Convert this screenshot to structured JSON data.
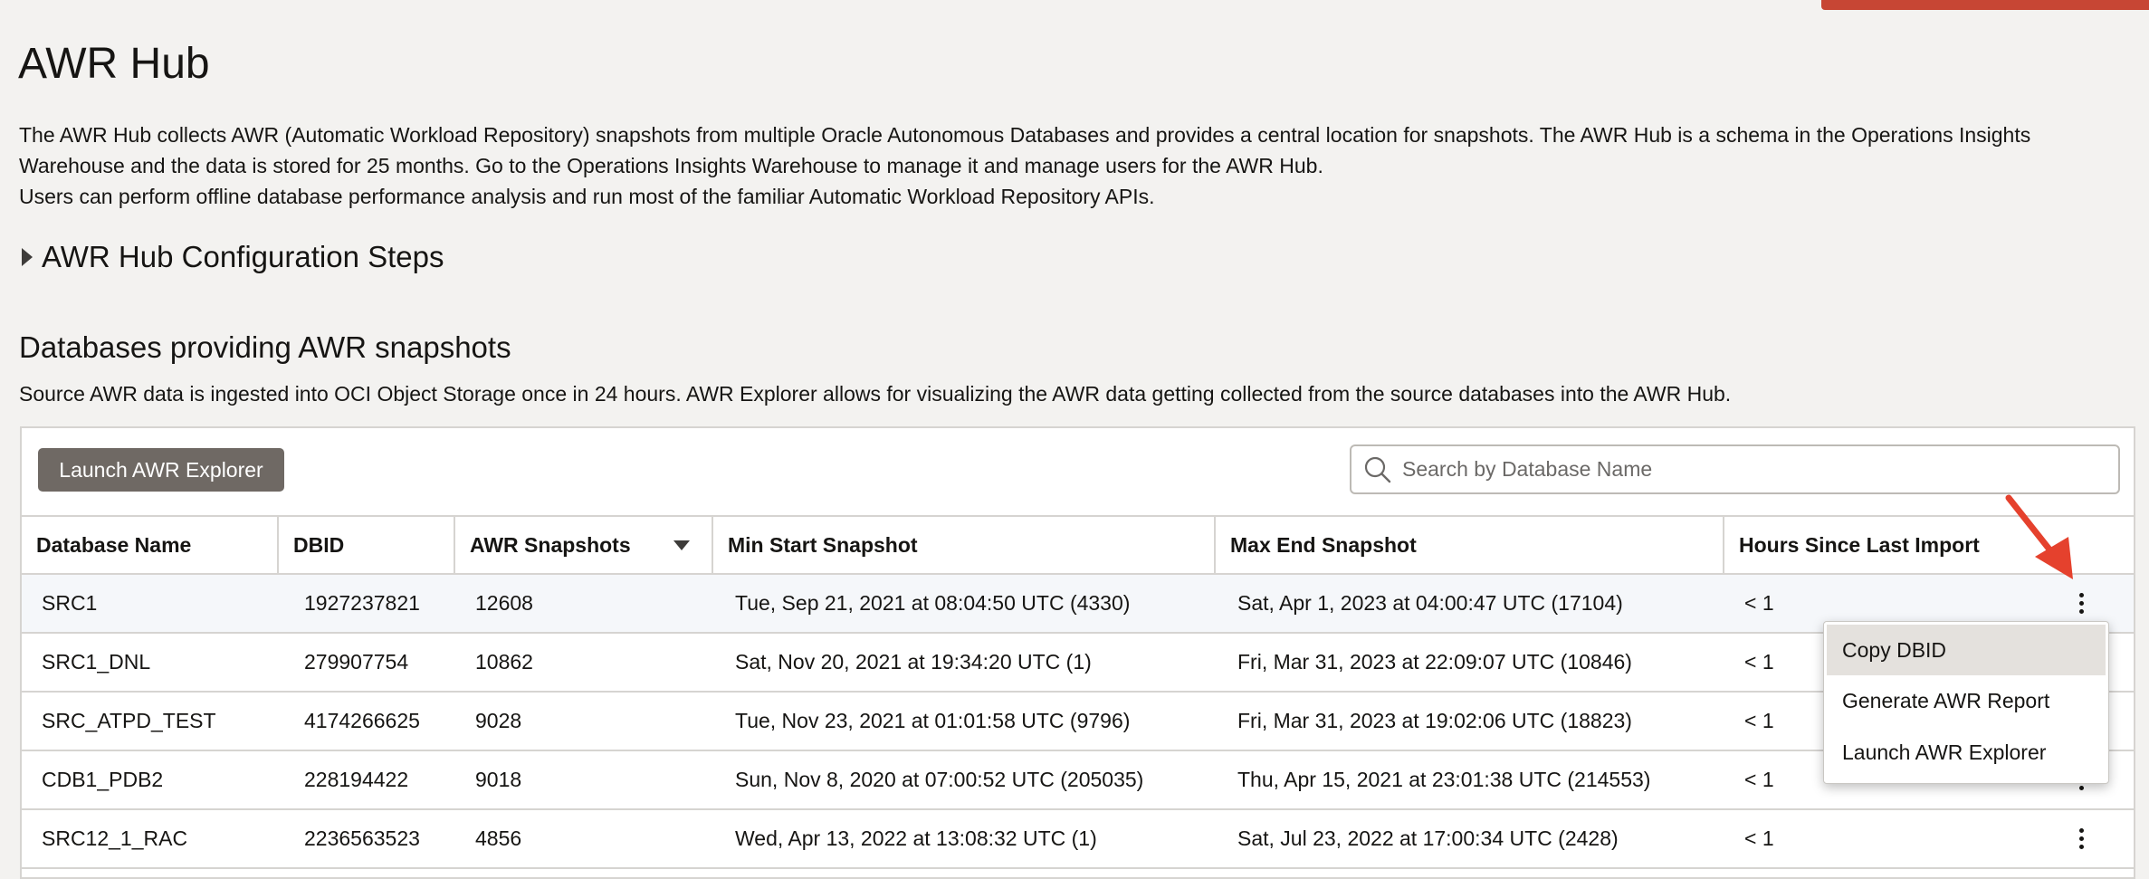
{
  "page": {
    "title": "AWR Hub",
    "intro_line1": "The AWR Hub collects AWR (Automatic Workload Repository) snapshots from multiple Oracle Autonomous Databases and provides a central location for snapshots. The AWR Hub is a schema in the Operations Insights Warehouse and the data is stored for 25 months. Go to the Operations Insights Warehouse to manage it and manage users for the AWR Hub.",
    "intro_line2": "Users can perform offline database performance analysis and run most of the familiar Automatic Workload Repository APIs."
  },
  "config_steps": {
    "label": "AWR Hub Configuration Steps"
  },
  "section": {
    "title": "Databases providing AWR snapshots",
    "description": "Source AWR data is ingested into OCI Object Storage once in 24 hours. AWR Explorer allows for visualizing the AWR data getting collected from the source databases into the AWR Hub."
  },
  "toolbar": {
    "launch_label": "Launch AWR Explorer"
  },
  "search": {
    "placeholder": "Search by Database Name",
    "value": ""
  },
  "table": {
    "columns": [
      "Database Name",
      "DBID",
      "AWR Snapshots",
      "Min Start Snapshot",
      "Max End Snapshot",
      "Hours Since Last Import"
    ],
    "rows": [
      [
        "SRC1",
        "1927237821",
        "12608",
        "Tue, Sep 21, 2021 at 08:04:50 UTC (4330)",
        "Sat, Apr 1, 2023 at 04:00:47 UTC (17104)",
        "< 1"
      ],
      [
        "SRC1_DNL",
        "279907754",
        "10862",
        "Sat, Nov 20, 2021 at 19:34:20 UTC (1)",
        "Fri, Mar 31, 2023 at 22:09:07 UTC (10846)",
        "< 1"
      ],
      [
        "SRC_ATPD_TEST",
        "4174266625",
        "9028",
        "Tue, Nov 23, 2021 at 01:01:58 UTC (9796)",
        "Fri, Mar 31, 2023 at 19:02:06 UTC (18823)",
        "< 1"
      ],
      [
        "CDB1_PDB2",
        "228194422",
        "9018",
        "Sun, Nov 8, 2020 at 07:00:52 UTC (205035)",
        "Thu, Apr 15, 2021 at 23:01:38 UTC (214553)",
        "< 1"
      ],
      [
        "SRC12_1_RAC",
        "2236563523",
        "4856",
        "Wed, Apr 13, 2022 at 13:08:32 UTC (1)",
        "Sat, Jul 23, 2022 at 17:00:34 UTC (2428)",
        "< 1"
      ]
    ]
  },
  "context_menu": {
    "items": [
      "Copy DBID",
      "Generate AWR Report",
      "Launch AWR Explorer"
    ]
  },
  "colors": {
    "accent": "#c74634",
    "button_bg": "#6f6964",
    "annotation_arrow": "#e5412d"
  }
}
